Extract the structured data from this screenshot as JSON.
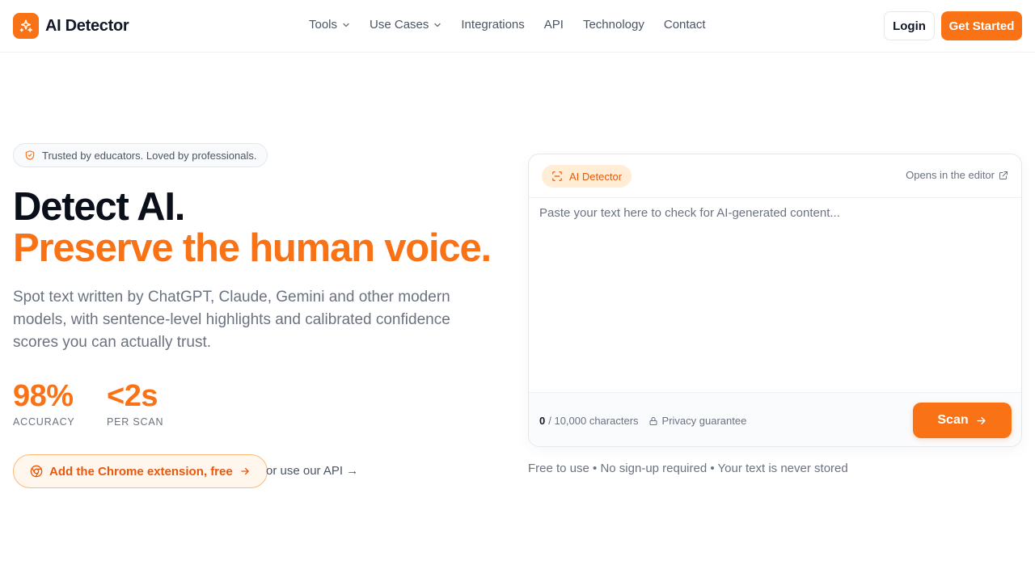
{
  "brand": {
    "name": "AI Detector"
  },
  "nav": {
    "items": [
      {
        "label": "Tools",
        "has_dropdown": true
      },
      {
        "label": "Use Cases",
        "has_dropdown": true
      },
      {
        "label": "Integrations",
        "has_dropdown": false
      },
      {
        "label": "API",
        "has_dropdown": false
      },
      {
        "label": "Technology",
        "has_dropdown": false
      },
      {
        "label": "Contact",
        "has_dropdown": false
      }
    ],
    "login_label": "Login",
    "get_started_label": "Get Started"
  },
  "hero": {
    "badge": "Trusted by educators. Loved by professionals.",
    "headline_line1": "Detect AI.",
    "headline_line2": "Preserve the human voice.",
    "subtitle": "Spot text written by ChatGPT, Claude, Gemini and other modern models, with sentence-level highlights and calibrated confidence scores you can actually trust.",
    "stats": [
      {
        "value": "98%",
        "label": "ACCURACY"
      },
      {
        "value": "<2s",
        "label": "PER SCAN"
      }
    ],
    "chrome_cta": "Add the Chrome extension, free",
    "api_link": "or use our API →"
  },
  "detector": {
    "pill_label": "AI Detector",
    "opens_editor": "Opens in the editor",
    "placeholder": "Paste your text here to check for AI-generated content...",
    "char_count": "0",
    "char_limit": "/ 10,000 characters",
    "privacy": "Privacy guarantee",
    "scan_label": "Scan",
    "footnote": "Free to use • No sign-up required • Your text is never stored"
  },
  "colors": {
    "accent": "#f97316",
    "accent_dark": "#ea580c",
    "text": "#111827",
    "muted": "#6b7280"
  },
  "icons": [
    "sparkles-icon",
    "chevron-down-icon",
    "shield-check-icon",
    "chrome-icon",
    "arrow-right-icon",
    "scan-icon",
    "external-link-icon",
    "lock-icon"
  ]
}
